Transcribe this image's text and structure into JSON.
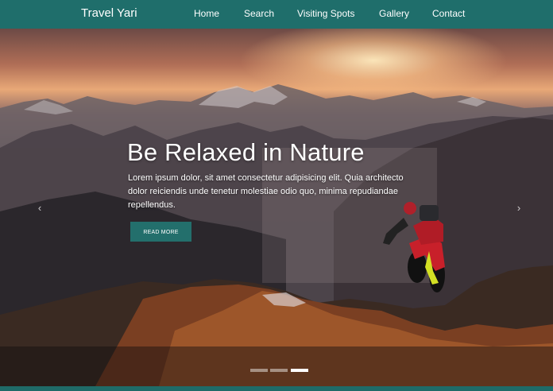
{
  "navbar": {
    "brand": "Travel Yari",
    "links": [
      "Home",
      "Search",
      "Visiting Spots",
      "Gallery",
      "Contact"
    ]
  },
  "hero": {
    "title": "Be Relaxed in Nature",
    "text": "Lorem ipsum dolor, sit amet consectetur adipisicing elit. Quia architecto dolor reiciendis unde tenetur molestiae odio quo, minima repudiandae repellendus.",
    "button_label": "READ MORE",
    "prev_icon": "‹",
    "next_icon": "›",
    "image_subject": "mountain biker on ridge at sunset"
  },
  "carousel": {
    "slide_count": 3,
    "active_index": 2
  },
  "colors": {
    "navbar": "#1f6e6b",
    "button": "#236f6c"
  }
}
